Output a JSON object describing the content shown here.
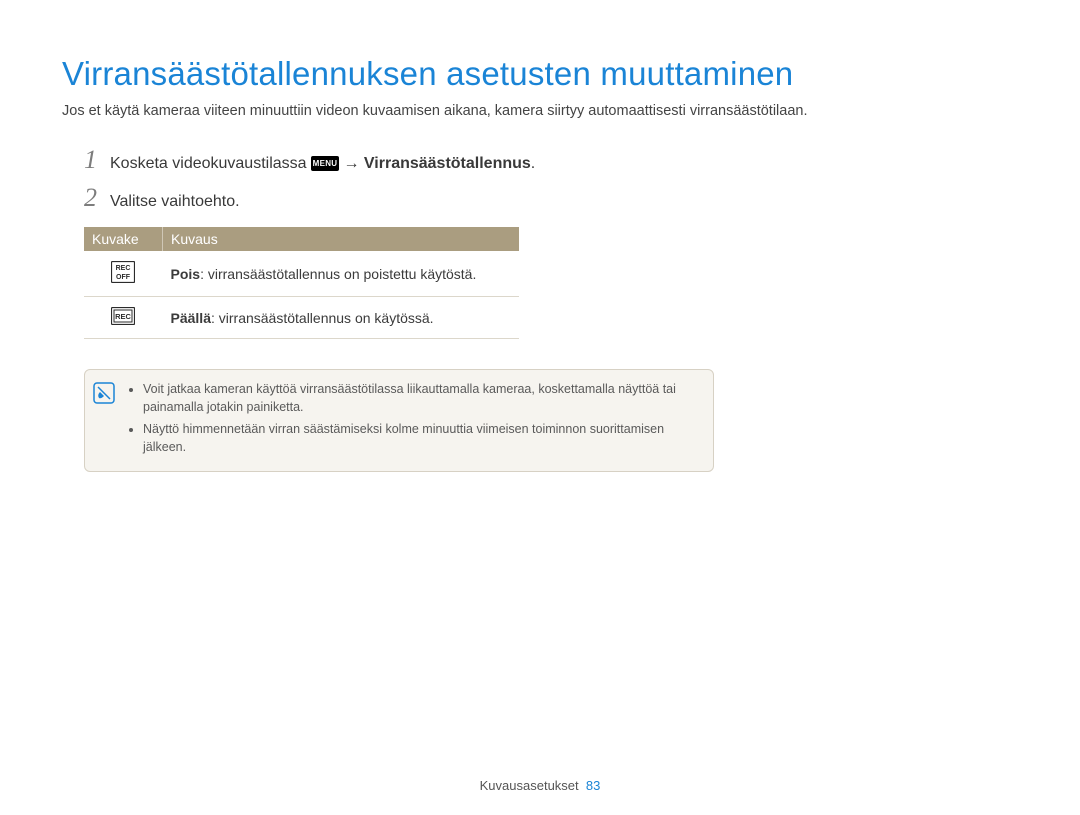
{
  "title": "Virransäästötallennuksen asetusten muuttaminen",
  "intro": "Jos et käytä kameraa viiteen minuuttiin videon kuvaamisen aikana, kamera siirtyy automaattisesti virransäästötilaan.",
  "steps": {
    "s1_num": "1",
    "s1_pre": "Kosketa videokuvaustilassa ",
    "s1_icon": "MENU",
    "s1_arrow": " → ",
    "s1_bold": "Virransäästötallennus",
    "s1_end": ".",
    "s2_num": "2",
    "s2_text": "Valitse vaihtoehto."
  },
  "table": {
    "headers": {
      "icon": "Kuvake",
      "desc": "Kuvaus"
    },
    "rows": [
      {
        "icon": "rec-off",
        "bold": "Pois",
        "text": ": virransäästötallennus on poistettu käytöstä."
      },
      {
        "icon": "rec-on",
        "bold": "Päällä",
        "text": ": virransäästötallennus on käytössä."
      }
    ]
  },
  "notes": [
    "Voit jatkaa kameran käyttöä virransäästötilassa liikauttamalla kameraa, koskettamalla näyttöä tai painamalla jotakin painiketta.",
    "Näyttö himmennetään virran säästämiseksi kolme minuuttia viimeisen toiminnon suorittamisen jälkeen."
  ],
  "footer": {
    "section": "Kuvausasetukset",
    "page": "83"
  }
}
